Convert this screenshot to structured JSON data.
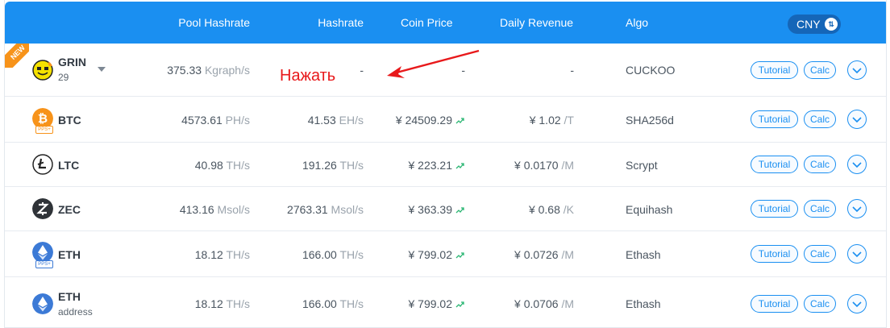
{
  "header": {
    "pool_hashrate": "Pool Hashrate",
    "hashrate": "Hashrate",
    "coin_price": "Coin Price",
    "daily_revenue": "Daily Revenue",
    "algo": "Algo",
    "currency": "CNY"
  },
  "annotation": "Нажать",
  "new_badge": "NEW",
  "buttons": {
    "tutorial": "Tutorial",
    "calc": "Calc"
  },
  "pps_label": "PPS+",
  "rows": [
    {
      "coin": "GRIN",
      "sub": "29",
      "pool_num": "375.33",
      "pool_unit": "Kgraph/s",
      "hash_num": "-",
      "hash_unit": "",
      "price": "-",
      "revenue": "-",
      "revenue_unit": "",
      "algo": "CUCKOO"
    },
    {
      "coin": "BTC",
      "sub": "",
      "pool_num": "4573.61",
      "pool_unit": "PH/s",
      "hash_num": "41.53",
      "hash_unit": "EH/s",
      "price": "¥ 24509.29",
      "revenue": "¥ 1.02",
      "revenue_unit": "/T",
      "algo": "SHA256d"
    },
    {
      "coin": "LTC",
      "sub": "",
      "pool_num": "40.98",
      "pool_unit": "TH/s",
      "hash_num": "191.26",
      "hash_unit": "TH/s",
      "price": "¥ 223.21",
      "revenue": "¥ 0.0170",
      "revenue_unit": "/M",
      "algo": "Scrypt"
    },
    {
      "coin": "ZEC",
      "sub": "",
      "pool_num": "413.16",
      "pool_unit": "Msol/s",
      "hash_num": "2763.31",
      "hash_unit": "Msol/s",
      "price": "¥ 363.39",
      "revenue": "¥ 0.68",
      "revenue_unit": "/K",
      "algo": "Equihash"
    },
    {
      "coin": "ETH",
      "sub": "",
      "pool_num": "18.12",
      "pool_unit": "TH/s",
      "hash_num": "166.00",
      "hash_unit": "TH/s",
      "price": "¥ 799.02",
      "revenue": "¥ 0.0726",
      "revenue_unit": "/M",
      "algo": "Ethash"
    },
    {
      "coin": "ETH",
      "sub": "address",
      "pool_num": "18.12",
      "pool_unit": "TH/s",
      "hash_num": "166.00",
      "hash_unit": "TH/s",
      "price": "¥ 799.02",
      "revenue": "¥ 0.0706",
      "revenue_unit": "/M",
      "algo": "Ethash"
    }
  ],
  "colors": {
    "header_bg": "#1a8ff1",
    "accent": "#1a8ff1",
    "annotation": "#e8191b",
    "trend": "#2bb673"
  }
}
